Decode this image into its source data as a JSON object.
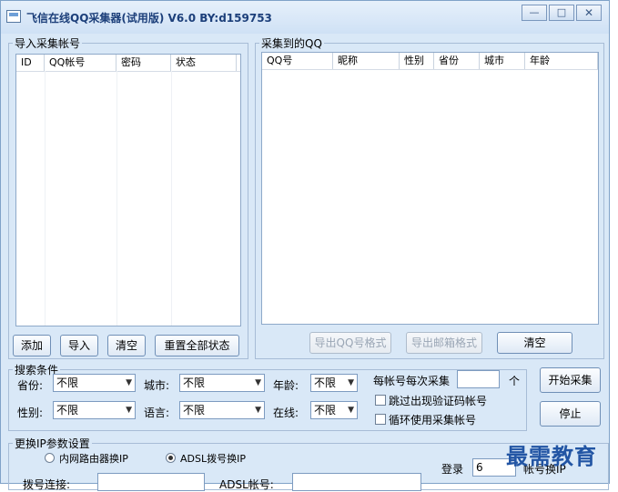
{
  "window": {
    "title": "飞信在线QQ采集器(试用版) V6.0   BY:d159753"
  },
  "controls": {
    "min": "—",
    "max": "□",
    "close": "✕"
  },
  "import_panel": {
    "legend": "导入采集帐号",
    "columns": [
      "ID",
      "QQ帐号",
      "密码",
      "状态"
    ],
    "buttons": {
      "add": "添加",
      "import": "导入",
      "clear": "清空",
      "reset": "重置全部状态"
    }
  },
  "result_panel": {
    "legend": "采集到的QQ",
    "columns": [
      "QQ号",
      "昵称",
      "性别",
      "省份",
      "城市",
      "年龄"
    ],
    "buttons": {
      "export_qq": "导出QQ号格式",
      "export_email": "导出邮箱格式",
      "clear": "清空"
    }
  },
  "search": {
    "legend": "搜索条件",
    "province_label": "省份:",
    "province_value": "不限",
    "city_label": "城市:",
    "city_value": "不限",
    "age_label": "年龄:",
    "age_value": "不限",
    "gender_label": "性别:",
    "gender_value": "不限",
    "language_label": "语言:",
    "language_value": "不限",
    "online_label": "在线:",
    "online_value": "不限",
    "per_account_label": "每帐号每次采集",
    "per_account_value": "",
    "per_account_unit": "个",
    "skip_captcha_label": "跳过出现验证码帐号",
    "loop_label": "循环使用采集帐号"
  },
  "actions": {
    "start": "开始采集",
    "stop": "停止"
  },
  "ip_settings": {
    "legend": "更换IP参数设置",
    "router_label": "内网路由器换IP",
    "adsl_label": "ADSL拨号换IP",
    "dial_label": "拨号连接:",
    "adsl_account_label": "ADSL帐号:",
    "login_label": "登录",
    "login_value": "6",
    "switch_label": "帐号换IP"
  },
  "watermark": "最需教育"
}
